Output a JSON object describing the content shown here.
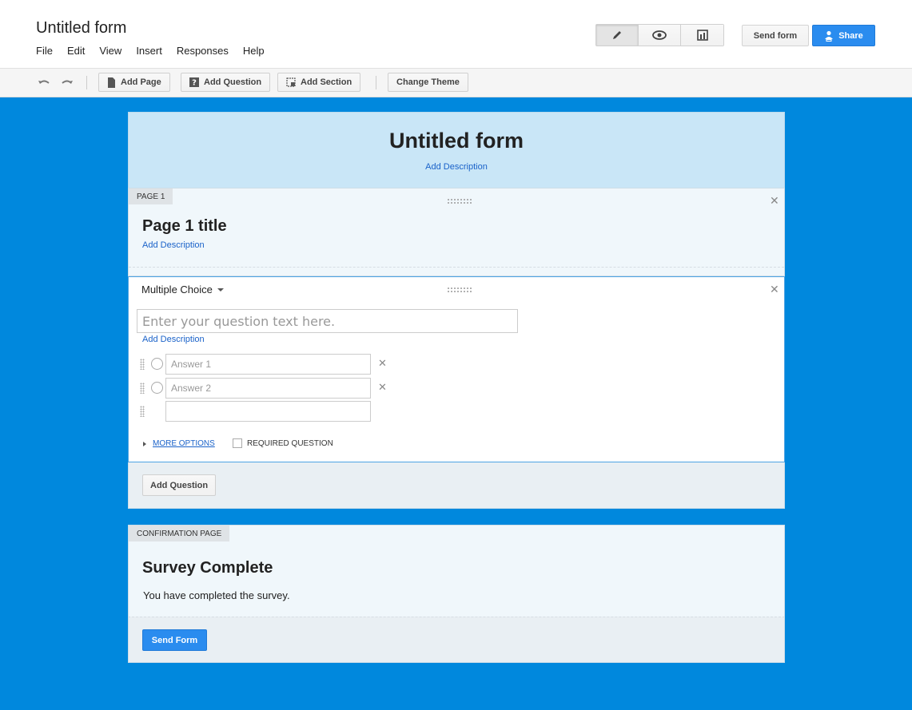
{
  "app": {
    "doc_title": "Untitled form",
    "menu": [
      "File",
      "Edit",
      "View",
      "Insert",
      "Responses",
      "Help"
    ],
    "send_form_label": "Send form",
    "share_label": "Share"
  },
  "toolbar": {
    "add_page": "Add Page",
    "add_question": "Add Question",
    "add_section": "Add Section",
    "change_theme": "Change Theme"
  },
  "form": {
    "title": "Untitled form",
    "add_description": "Add Description"
  },
  "page1": {
    "tag": "PAGE 1",
    "title": "Page 1 title",
    "add_description": "Add Description"
  },
  "question": {
    "type": "Multiple Choice",
    "placeholder": "Enter your question text here.",
    "add_description": "Add Description",
    "answers": [
      "Answer 1",
      "Answer 2"
    ],
    "more_options": "MORE OPTIONS",
    "required": "REQUIRED QUESTION"
  },
  "add_question_button": "Add Question",
  "confirmation": {
    "tag": "CONFIRMATION PAGE",
    "title": "Survey Complete",
    "text": "You have completed the survey.",
    "send_button": "Send Form"
  },
  "colors": {
    "background": "#0088dd",
    "accent": "#2a8cef",
    "link": "#1a62c9",
    "header_band": "#c9e6f7"
  }
}
